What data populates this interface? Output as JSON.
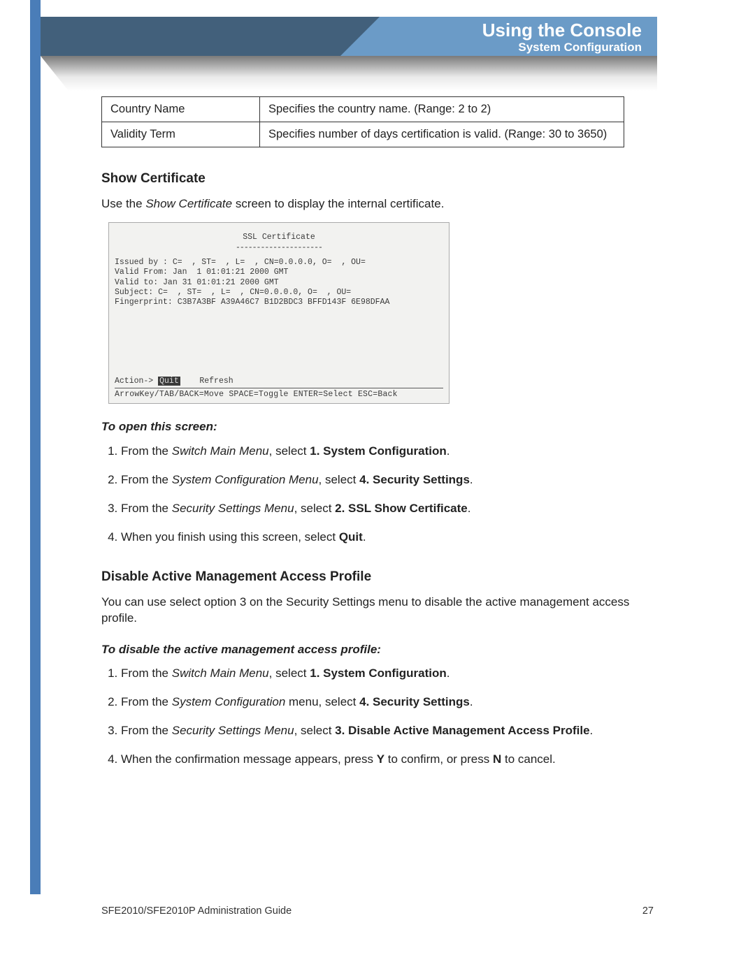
{
  "header": {
    "title": "Using the Console",
    "subtitle": "System Configuration"
  },
  "table": {
    "rows": [
      {
        "label": "Country Name",
        "desc": "Specifies the country name. (Range: 2 to 2)"
      },
      {
        "label": "Validity Term",
        "desc": "Specifies number of days certification is valid. (Range: 30 to 3650)"
      }
    ]
  },
  "show_cert": {
    "heading": "Show Certificate",
    "intro_pre": "Use the ",
    "intro_em": "Show Certificate",
    "intro_post": " screen to display the internal certificate."
  },
  "terminal": {
    "title": "SSL Certificate",
    "rule": "---------------------",
    "body": "Issued by : C=  , ST=  , L=  , CN=0.0.0.0, O=  , OU=\nValid From: Jan  1 01:01:21 2000 GMT\nValid to: Jan 31 01:01:21 2000 GMT\nSubject: C=  , ST=  , L=  , CN=0.0.0.0, O=  , OU=\nFingerprint: C3B7A3BF A39A46C7 B1D2BDC3 BFFD143F 6E98DFAA",
    "action_label": "Action->",
    "action_highlight": "Quit",
    "action_refresh": "Refresh",
    "hint": "ArrowKey/TAB/BACK=Move  SPACE=Toggle  ENTER=Select  ESC=Back"
  },
  "open_screen": {
    "heading": "To open this screen:",
    "steps": [
      {
        "pre": "From the ",
        "em": "Switch Main Menu",
        "mid": ", select ",
        "bold": "1. System Configuration",
        "post": "."
      },
      {
        "pre": "From the ",
        "em": "System Configuration Menu",
        "mid": ", select ",
        "bold": "4. Security Settings",
        "post": "."
      },
      {
        "pre": "From the ",
        "em": "Security Settings Menu",
        "mid": ", select ",
        "bold": "2. SSL Show Certificate",
        "post": "."
      },
      {
        "pre": "When you finish using this screen, select ",
        "em": "",
        "mid": "",
        "bold": "Quit",
        "post": "."
      }
    ]
  },
  "disable_profile": {
    "heading": "Disable Active Management Access Profile",
    "intro": "You can use select option 3 on the Security Settings menu to disable the active management access profile.",
    "sub_heading": "To disable the active management access profile:",
    "steps": [
      {
        "pre": "From the ",
        "em": "Switch Main Menu",
        "mid": ", select ",
        "bold": "1. System Configuration",
        "post": "."
      },
      {
        "pre": "From the ",
        "em": "System Configuration",
        "mid": " menu, select ",
        "bold": "4. Security Settings",
        "post": "."
      },
      {
        "pre": "From the ",
        "em": "Security Settings Menu",
        "mid": ", select ",
        "bold": "3. Disable Active Management Access Profile",
        "post": "."
      },
      {
        "pre": "When the confirmation message appears, press ",
        "em": "",
        "mid": "",
        "bold": "Y",
        "post_mid": " to confirm, or press ",
        "bold2": "N",
        "post": " to cancel."
      }
    ]
  },
  "footer": {
    "guide": "SFE2010/SFE2010P Administration Guide",
    "page": "27"
  }
}
